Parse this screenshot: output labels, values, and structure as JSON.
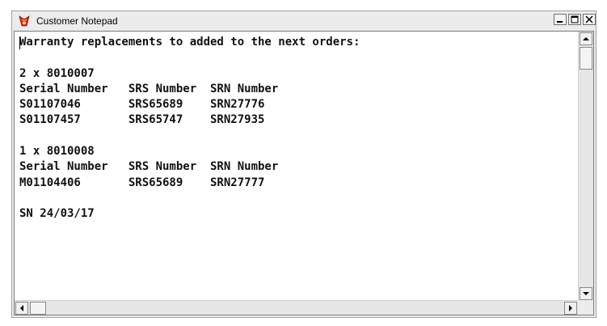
{
  "window": {
    "title": "Customer Notepad",
    "icon": "notepad-app-icon",
    "controls": [
      "minimize-icon",
      "maximize-icon",
      "close-icon"
    ]
  },
  "document": {
    "lines": [
      "Warranty replacements to added to the next orders:",
      "",
      "2 x 8010007",
      "Serial Number   SRS Number  SRN Number",
      "S01107046       SRS65689    SRN27776",
      "S01107457       SRS65747    SRN27935",
      "",
      "1 x 8010008",
      "Serial Number   SRS Number  SRN Number",
      "M01104406       SRS65689    SRN27777",
      "",
      "SN 24/03/17"
    ]
  },
  "colors": {
    "window_bg": "#ececec",
    "text": "#111111",
    "editor_bg": "#ffffff",
    "icon_red": "#d8281f"
  }
}
